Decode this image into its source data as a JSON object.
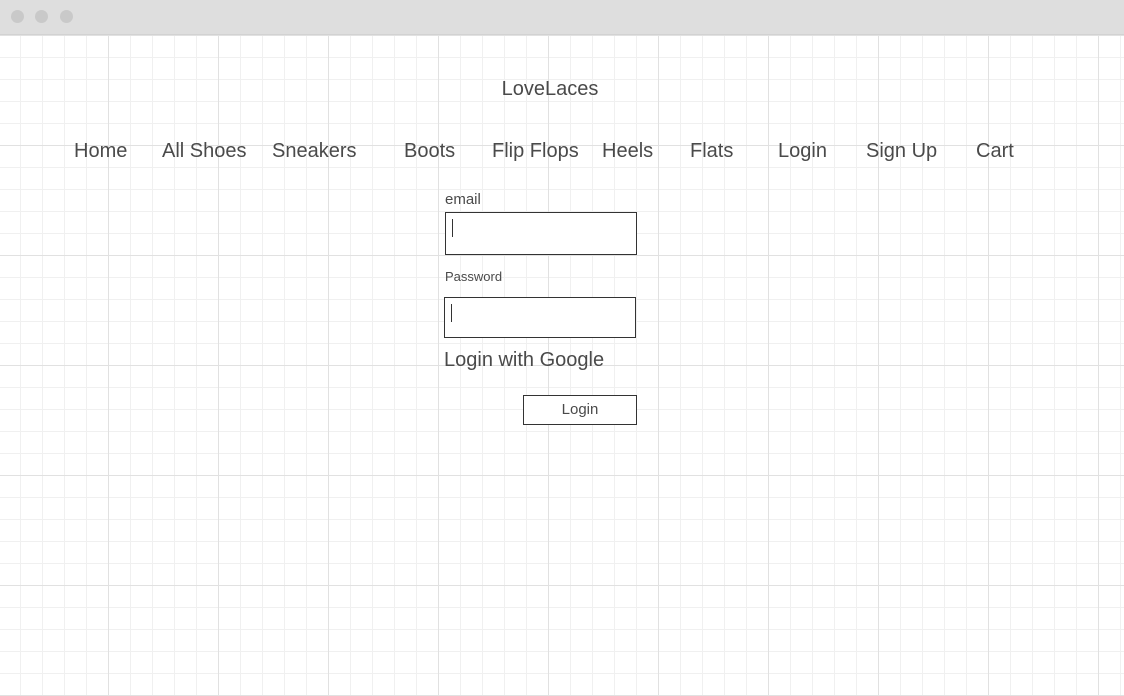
{
  "site": {
    "title": "LoveLaces"
  },
  "nav": {
    "items": [
      "Home",
      "All Shoes",
      "Sneakers",
      "Boots",
      "Flip Flops",
      "Heels",
      "Flats",
      "Login",
      "Sign Up",
      "Cart"
    ]
  },
  "form": {
    "email_label": "email",
    "email_value": "",
    "password_label": "Password",
    "password_value": "",
    "google_link": "Login with Google",
    "submit_label": "Login"
  },
  "icons": {
    "window_controls": [
      "close-dot",
      "minimize-dot",
      "zoom-dot"
    ]
  },
  "colors": {
    "text": "#4a4a4a",
    "titlebar": "#dedede",
    "window_control": "#c9c9c9",
    "border": "#333333",
    "grid_major": "#e1e1e1",
    "grid_minor": "#f0f0f0"
  }
}
